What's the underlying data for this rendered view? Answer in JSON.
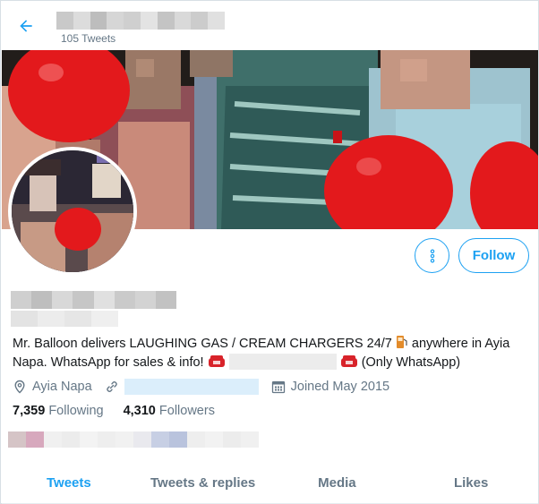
{
  "header": {
    "tweets_count": "105 Tweets",
    "back_icon": "arrow-left-icon"
  },
  "actions": {
    "more_icon": "more-vertical-icon",
    "follow_label": "Follow"
  },
  "profile": {
    "bio_part1": "Mr. Balloon delivers LAUGHING GAS / CREAM CHARGERS 24/7 ",
    "bio_part2": " anywhere in Ayia Napa. WhatsApp for sales & info! ",
    "bio_part3": " (Only WhatsApp)",
    "location": "Ayia Napa",
    "joined": "Joined May 2015"
  },
  "stats": {
    "following_count": "7,359",
    "following_label": "Following",
    "followers_count": "4,310",
    "followers_label": "Followers"
  },
  "tabs": [
    {
      "label": "Tweets",
      "active": true
    },
    {
      "label": "Tweets & replies",
      "active": false
    },
    {
      "label": "Media",
      "active": false
    },
    {
      "label": "Likes",
      "active": false
    }
  ],
  "colors": {
    "accent": "#1da1f2",
    "secondary_text": "#657786",
    "balloon_red": "#e3191c"
  }
}
